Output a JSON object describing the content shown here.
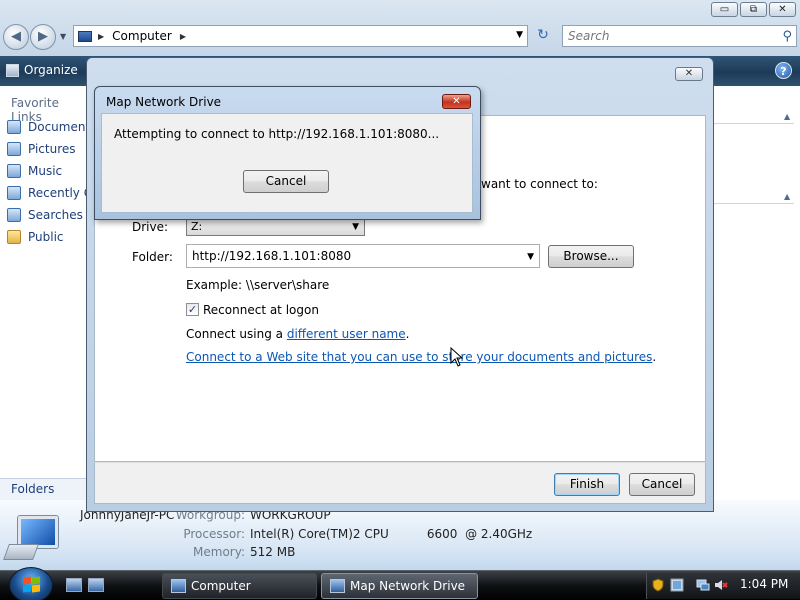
{
  "explorer": {
    "caption": {
      "minimize": "▭",
      "maximize": "⧉",
      "close": "✕"
    },
    "nav": {
      "back": "◀",
      "forward": "▶",
      "dropdown": "▼"
    },
    "address": {
      "location": "Computer",
      "sep": "▶",
      "dropdown": "▼"
    },
    "refresh": "↻",
    "search": {
      "placeholder": "Search",
      "icon": "⚲"
    },
    "toolbar": {
      "organize": "Organize",
      "help": "?"
    },
    "favorites": {
      "title": "Favorite Links",
      "items": [
        "Documents",
        "Pictures",
        "Music",
        "Recently Changed",
        "Searches",
        "Public"
      ]
    },
    "folders_label": "Folders",
    "right_pane": {
      "chevron": "▲"
    },
    "details": {
      "computer_name": "JohnnyJaneJr-PC",
      "workgroup_label": "Workgroup:",
      "workgroup": "WORKGROUP",
      "processor_label": "Processor:",
      "processor": "Intel(R) Core(TM)2 CPU          6600  @ 2.40GHz",
      "memory_label": "Memory:",
      "memory": "512 MB"
    }
  },
  "wizard": {
    "close": "✕",
    "intro_fragment": "want to connect to:",
    "drive_label": "Drive:",
    "drive_value": "Z:",
    "folder_label": "Folder:",
    "folder_value": "http://192.168.1.101:8080",
    "browse": "Browse...",
    "example": "Example: \\\\server\\share",
    "reconnect_checked": "✓",
    "reconnect_label": "Reconnect at logon",
    "connect_prefix": "Connect using a ",
    "connect_link": "different user name",
    "connect_suffix": ".",
    "web_link": "Connect to a Web site that you can use to store your documents and pictures",
    "web_suffix": ".",
    "finish": "Finish",
    "cancel": "Cancel"
  },
  "progress_dialog": {
    "title": "Map Network Drive",
    "close": "✕",
    "message": "Attempting to connect to http://192.168.1.101:8080...",
    "cancel": "Cancel"
  },
  "taskbar": {
    "tasks": [
      "Computer",
      "Map Network Drive"
    ],
    "clock": "1:04 PM"
  },
  "colors": {
    "link": "#0b57b4",
    "toolbar": "#1d3b58",
    "taskbar": "#0f1114"
  }
}
